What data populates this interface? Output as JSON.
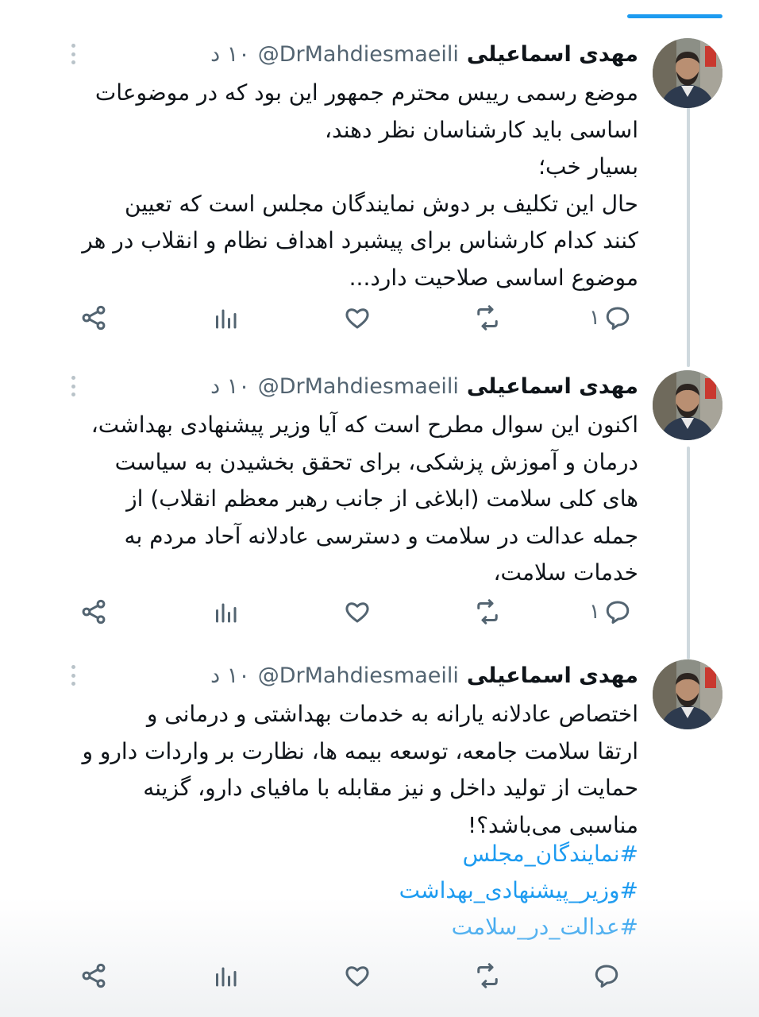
{
  "author": {
    "display_name": "مهدی اسماعیلی",
    "handle": "@DrMahdiesmaeili",
    "time": "۱۰ د"
  },
  "tweets": [
    {
      "text": "موضع رسمی رییس محترم جمهور این بود که در موضوعات\nاساسی باید کارشناسان نظر دهند،\nبسیار خب؛\nحال این تکلیف بر دوش نمایندگان مجلس است که تعیین\nکنند کدام کارشناس برای پیشبرد اهداف نظام و انقلاب در هر\nموضوع اساسی صلاحیت دارد...",
      "reply_count": "۱"
    },
    {
      "text": "اکنون این سوال مطرح است که آیا وزیر پیشنهادی بهداشت،\nدرمان و آموزش پزشکی، برای تحقق بخشیدن به سیاست\nهای کلی سلامت (ابلاغی از جانب رهبر معظم انقلاب) از\nجمله عدالت در سلامت و دسترسی عادلانه آحاد مردم به\nخدمات سلامت،",
      "reply_count": "۱"
    },
    {
      "text": "اختصاص عادلانه یارانه به خدمات بهداشتی و درمانی و\nارتقا سلامت جامعه، توسعه بیمه ها، نظارت بر واردات دارو و\nحمایت از تولید داخل و نیز مقابله با مافیای دارو، گزینه\nمناسبی می‌باشد؟!",
      "hashtags": [
        "#نمایندگان_مجلس",
        "#وزیر_پیشنهادی_بهداشت",
        "#عدالت_در_سلامت"
      ],
      "reply_count": ""
    }
  ],
  "icons": {
    "reply": "reply-icon",
    "retweet": "retweet-icon",
    "like": "heart-icon",
    "views": "views-chart-icon",
    "share": "share-icon",
    "more": "more-vertical-icon"
  },
  "colors": {
    "accent": "#1d9bf0",
    "secondary_text": "#536471",
    "thread_line": "#cfd9de"
  }
}
